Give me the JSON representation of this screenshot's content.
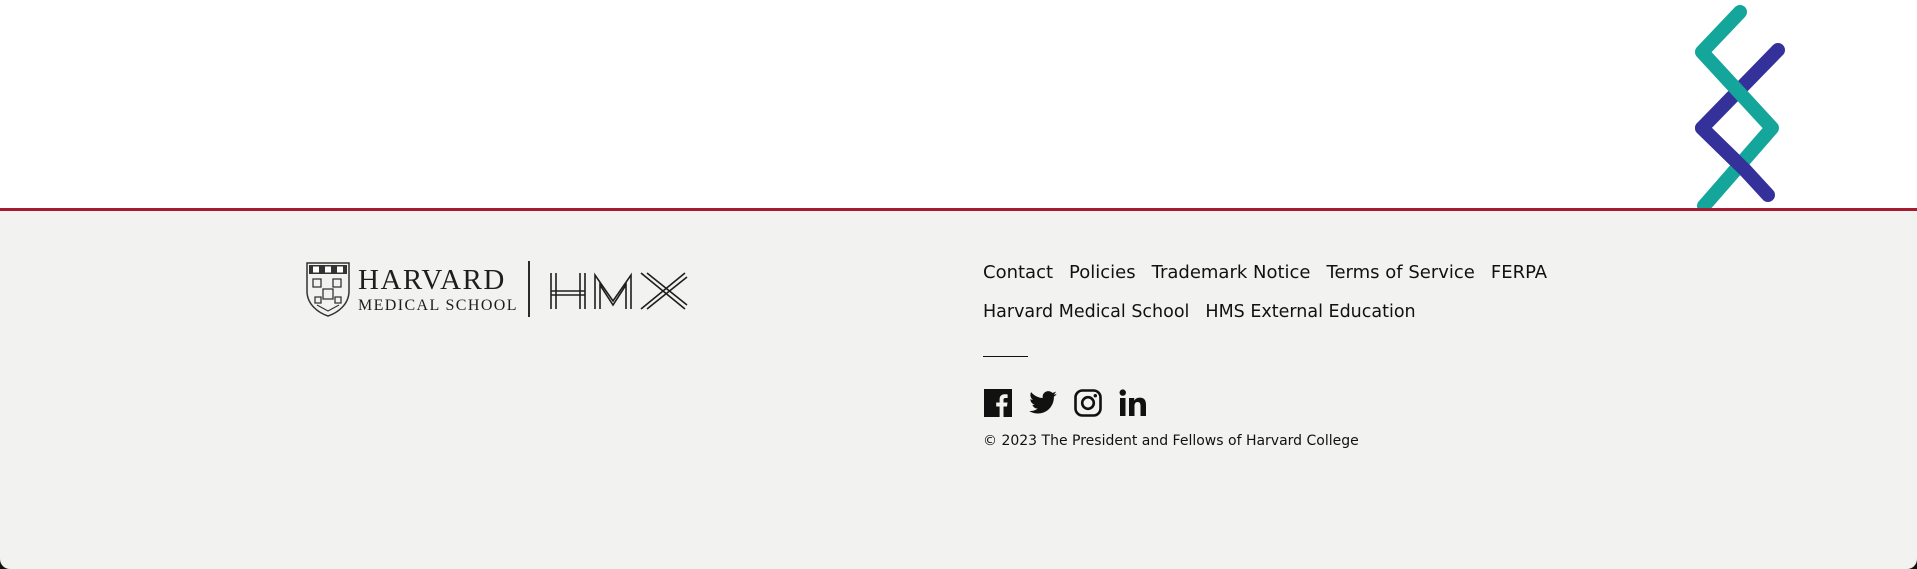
{
  "logo": {
    "line1": "HARVARD",
    "line2": "MEDICAL SCHOOL",
    "alt": "HMX"
  },
  "nav": {
    "primary": [
      {
        "label": "Contact"
      },
      {
        "label": "Policies"
      },
      {
        "label": "Trademark Notice"
      },
      {
        "label": "Terms of Service"
      },
      {
        "label": "FERPA"
      }
    ],
    "secondary": [
      {
        "label": "Harvard Medical School"
      },
      {
        "label": "HMS External Education"
      }
    ]
  },
  "social": [
    {
      "name": "facebook-icon"
    },
    {
      "name": "twitter-icon"
    },
    {
      "name": "instagram-icon"
    },
    {
      "name": "linkedin-icon"
    }
  ],
  "copyright": "© 2023 The President and Fellows of Harvard College",
  "colors": {
    "accent_line": "#a51c30",
    "helix_teal": "#14a59b",
    "helix_indigo": "#35319a",
    "footer_bg": "#f2f2f0"
  }
}
